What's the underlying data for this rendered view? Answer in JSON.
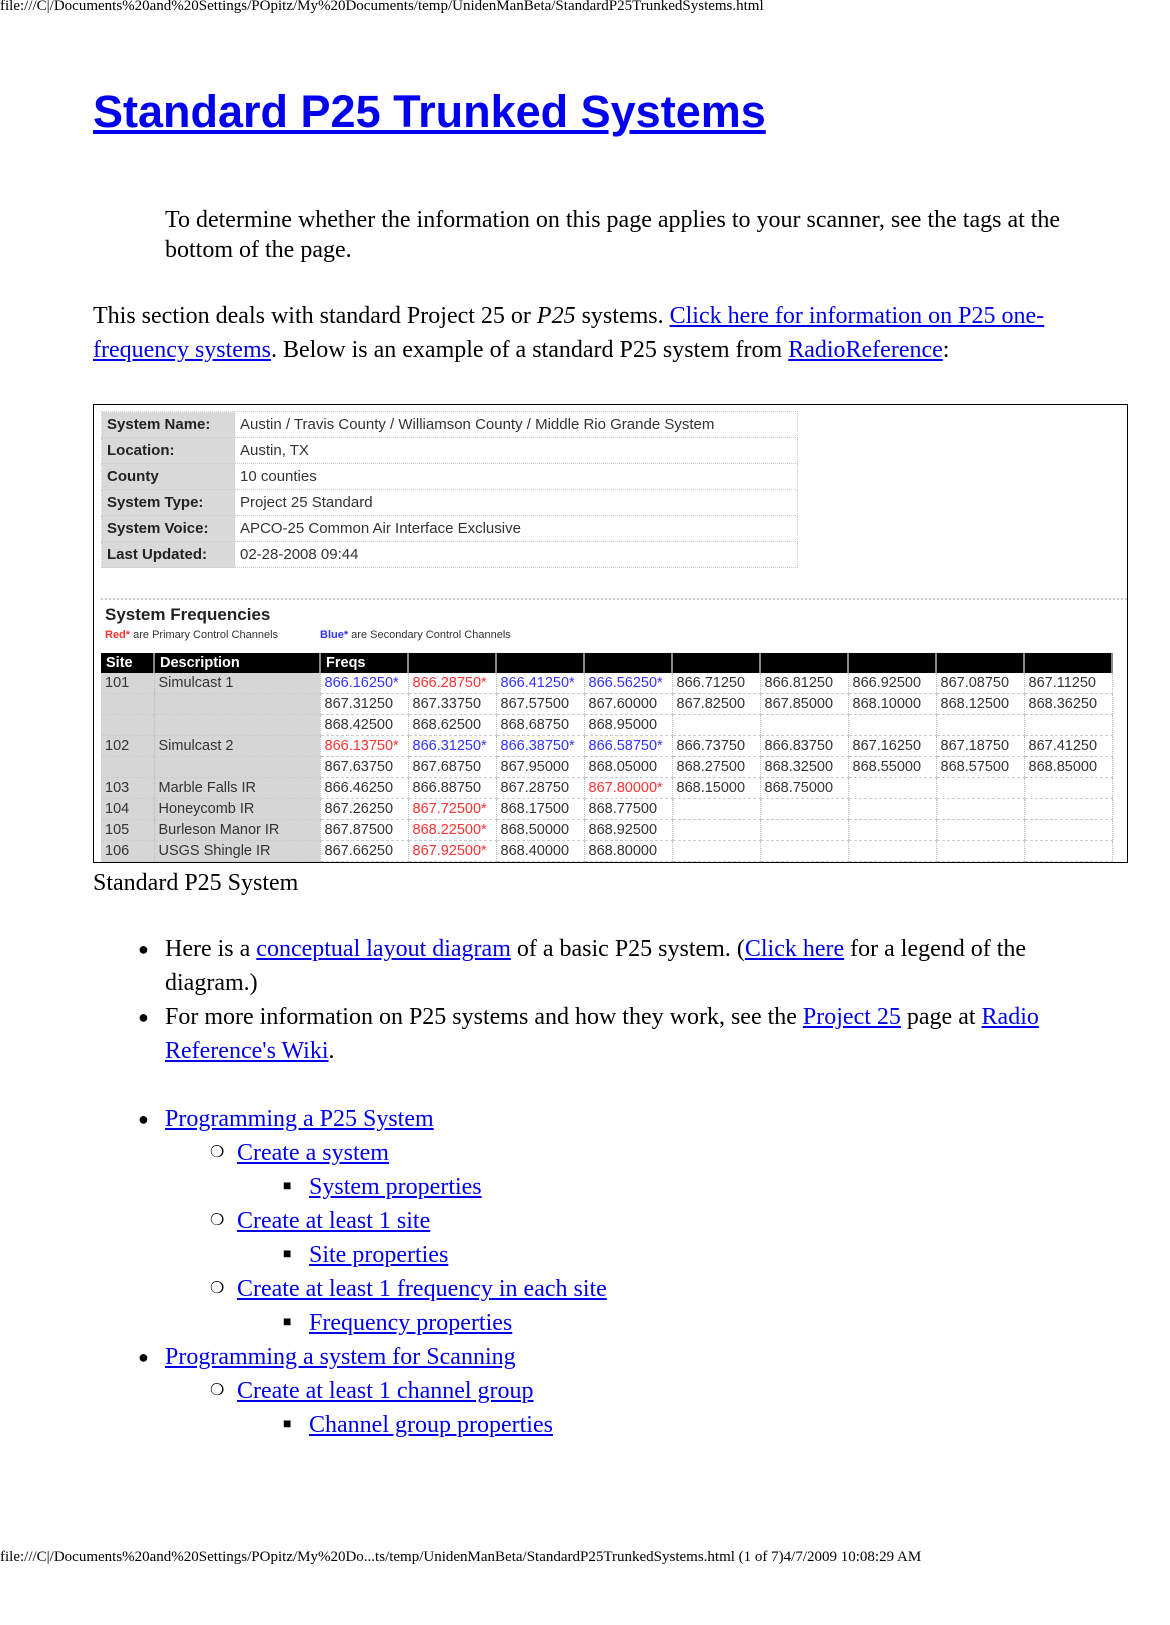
{
  "header_url": "file:///C|/Documents%20and%20Settings/POpitz/My%20Documents/temp/UnidenManBeta/StandardP25TrunkedSystems.html",
  "footer": "file:///C|/Documents%20and%20Settings/POpitz/My%20Do...ts/temp/UnidenManBeta/StandardP25TrunkedSystems.html (1 of 7)4/7/2009 10:08:29 AM",
  "title": "Standard P25 Trunked Systems",
  "intro": "To determine whether the information on this page applies to your scanner, see the tags at the bottom of the page.",
  "para": {
    "t1": "This section deals with standard Project 25 or ",
    "t2": "P25",
    "t3": " systems. ",
    "link1": "Click here for information on P25 one-frequency systems",
    "t4": ". Below is an example of a standard P25 system from ",
    "link2": "RadioReference",
    "t5": ":"
  },
  "figure": {
    "info": [
      {
        "label": "System Name:",
        "value": "Austin / Travis County / Williamson County / Middle Rio Grande System"
      },
      {
        "label": "Location:",
        "value": "Austin, TX"
      },
      {
        "label": "County",
        "value": "10 counties"
      },
      {
        "label": "System Type:",
        "value": "Project 25 Standard"
      },
      {
        "label": "System Voice:",
        "value": "APCO-25 Common Air Interface Exclusive"
      },
      {
        "label": "Last Updated:",
        "value": "02-28-2008 09:44"
      }
    ],
    "freq_title": "System Frequencies",
    "legend_red_key": "Red*",
    "legend_red_text": " are Primary Control Channels",
    "legend_blue_key": "Blue*",
    "legend_blue_text": " are Secondary Control Channels",
    "colors": {
      "primary": "#ff3333",
      "secondary": "#3333ff"
    },
    "headers": [
      "Site",
      "Description",
      "Freqs"
    ],
    "rows": [
      {
        "site": "101",
        "desc": "Simulcast 1",
        "freqs": [
          [
            "866.16250*",
            "s"
          ],
          [
            "866.28750*",
            "p"
          ],
          [
            "866.41250*",
            "s"
          ],
          [
            "866.56250*",
            "s"
          ],
          [
            "866.71250"
          ],
          [
            "866.81250"
          ],
          [
            "866.92500"
          ],
          [
            "867.08750"
          ],
          [
            "867.11250"
          ]
        ]
      },
      {
        "site": "",
        "desc": "",
        "freqs": [
          [
            "867.31250"
          ],
          [
            "867.33750"
          ],
          [
            "867.57500"
          ],
          [
            "867.60000"
          ],
          [
            "867.82500"
          ],
          [
            "867.85000"
          ],
          [
            "868.10000"
          ],
          [
            "868.12500"
          ],
          [
            "868.36250"
          ]
        ]
      },
      {
        "site": "",
        "desc": "",
        "freqs": [
          [
            "868.42500"
          ],
          [
            "868.62500"
          ],
          [
            "868.68750"
          ],
          [
            "868.95000"
          ]
        ]
      },
      {
        "site": "102",
        "desc": "Simulcast 2",
        "freqs": [
          [
            "866.13750*",
            "p"
          ],
          [
            "866.31250*",
            "s"
          ],
          [
            "866.38750*",
            "s"
          ],
          [
            "866.58750*",
            "s"
          ],
          [
            "866.73750"
          ],
          [
            "866.83750"
          ],
          [
            "867.16250"
          ],
          [
            "867.18750"
          ],
          [
            "867.41250"
          ]
        ]
      },
      {
        "site": "",
        "desc": "",
        "freqs": [
          [
            "867.63750"
          ],
          [
            "867.68750"
          ],
          [
            "867.95000"
          ],
          [
            "868.05000"
          ],
          [
            "868.27500"
          ],
          [
            "868.32500"
          ],
          [
            "868.55000"
          ],
          [
            "868.57500"
          ],
          [
            "868.85000"
          ]
        ]
      },
      {
        "site": "103",
        "desc": "Marble Falls IR",
        "freqs": [
          [
            "866.46250"
          ],
          [
            "866.88750"
          ],
          [
            "867.28750"
          ],
          [
            "867.80000*",
            "p"
          ],
          [
            "868.15000"
          ],
          [
            "868.75000"
          ]
        ]
      },
      {
        "site": "104",
        "desc": "Honeycomb IR",
        "freqs": [
          [
            "867.26250"
          ],
          [
            "867.72500*",
            "p"
          ],
          [
            "868.17500"
          ],
          [
            "868.77500"
          ]
        ]
      },
      {
        "site": "105",
        "desc": "Burleson Manor IR",
        "freqs": [
          [
            "867.87500"
          ],
          [
            "868.22500*",
            "p"
          ],
          [
            "868.50000"
          ],
          [
            "868.92500"
          ]
        ]
      },
      {
        "site": "106",
        "desc": "USGS Shingle IR",
        "freqs": [
          [
            "867.66250"
          ],
          [
            "867.92500*",
            "p"
          ],
          [
            "868.40000"
          ],
          [
            "868.80000"
          ]
        ]
      }
    ]
  },
  "caption": "Standard P25 System",
  "bullets": {
    "b1": {
      "t1": "Here is a ",
      "link1": "conceptual layout diagram",
      "t2": " of a basic P25 system. (",
      "link2": "Click here",
      "t3": " for a legend of the diagram.)"
    },
    "b2": {
      "t1": "For more information on P25 systems and how they work, see the ",
      "link1": "Project 25",
      "t2": " page at ",
      "link2": "Radio Reference's Wiki",
      "t3": "."
    }
  },
  "toc": [
    {
      "level": 1,
      "label": "Programming a P25 System"
    },
    {
      "level": 2,
      "label": "Create a system"
    },
    {
      "level": 3,
      "label": "System properties"
    },
    {
      "level": 2,
      "label": "Create at least 1 site"
    },
    {
      "level": 3,
      "label": "Site properties"
    },
    {
      "level": 2,
      "label": "Create at least 1 frequency in each site"
    },
    {
      "level": 3,
      "label": "Frequency properties"
    },
    {
      "level": 1,
      "label": "Programming a system for Scanning"
    },
    {
      "level": 2,
      "label": "Create at least 1 channel group"
    },
    {
      "level": 3,
      "label": "Channel group properties"
    }
  ]
}
